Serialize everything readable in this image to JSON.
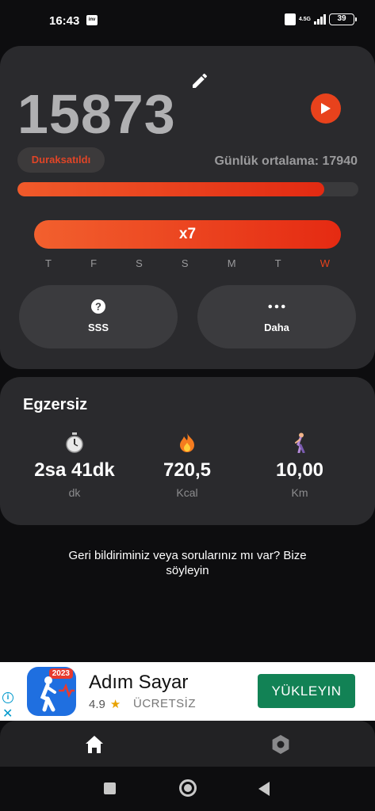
{
  "status_bar": {
    "time": "16:43",
    "app_badge": "inv",
    "volte": "Vo LTE",
    "network": "4.5G",
    "battery": "39"
  },
  "steps_card": {
    "steps": "15873",
    "paused_label": "Duraksatıldı",
    "daily_average": "Günlük ortalama: 17940",
    "progress_fraction": 0.9,
    "streak_label": "x7",
    "days": [
      "T",
      "F",
      "S",
      "S",
      "M",
      "T",
      "W"
    ],
    "today_index": 6,
    "faq_label": "SSS",
    "more_label": "Daha",
    "accent_color": "#e8421c"
  },
  "exercise": {
    "title": "Egzersiz",
    "metrics": [
      {
        "icon": "stopwatch-icon",
        "value": "2sa 41dk",
        "unit": "dk"
      },
      {
        "icon": "fire-icon",
        "value": "720,5",
        "unit": "Kcal"
      },
      {
        "icon": "walking-icon",
        "value": "10,00",
        "unit": "Km"
      }
    ]
  },
  "feedback": "Geri bildiriminiz veya sorularınız mı var? Bize söyleyin",
  "ad": {
    "year": "2023",
    "app_name": "Adım Sayar",
    "rating": "4.9",
    "price": "ÜCRETSİZ",
    "install_label": "YÜKLEYIN"
  }
}
